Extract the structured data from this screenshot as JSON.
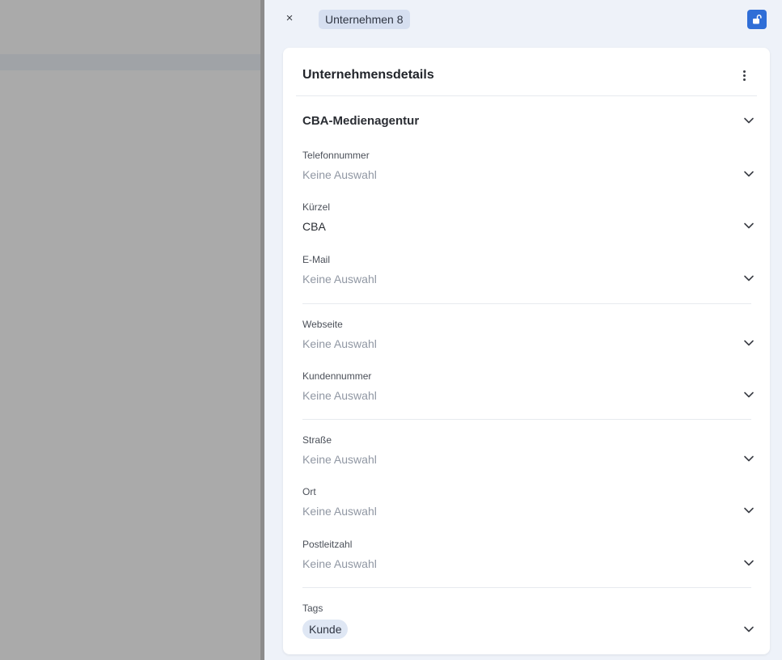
{
  "header": {
    "close_glyph": "×",
    "title": "Unternehmen 8",
    "lock_icon": "unlock-icon"
  },
  "card": {
    "title": "Unternehmensdetails",
    "company_name": "CBA-Medienagentur",
    "fields": {
      "telefonnummer": {
        "label": "Telefonnummer",
        "value": "Keine Auswahl"
      },
      "kuerzel": {
        "label": "Kürzel",
        "value": "CBA"
      },
      "email": {
        "label": "E-Mail",
        "value": "Keine Auswahl"
      },
      "webseite": {
        "label": "Webseite",
        "value": "Keine Auswahl"
      },
      "kundennummer": {
        "label": "Kundennummer",
        "value": "Keine Auswahl"
      },
      "strasse": {
        "label": "Straße",
        "value": "Keine Auswahl"
      },
      "ort": {
        "label": "Ort",
        "value": "Keine Auswahl"
      },
      "postleitzahl": {
        "label": "Postleitzahl",
        "value": "Keine Auswahl"
      },
      "tags": {
        "label": "Tags",
        "value": "Kunde"
      }
    }
  },
  "colors": {
    "accent": "#2f6ed7",
    "panel_bg": "#eef2f9",
    "placeholder": "#9097a3"
  }
}
